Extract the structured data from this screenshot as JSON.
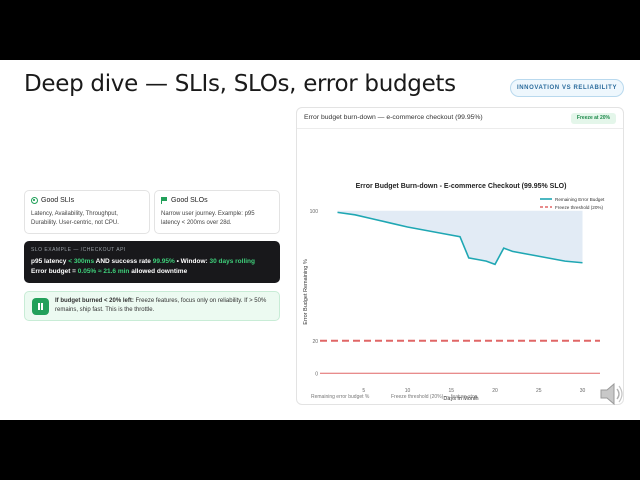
{
  "slide": {
    "title": "Deep dive — SLIs, SLOs, error budgets",
    "tag": "INNOVATION VS RELIABILITY"
  },
  "cards": {
    "sli": {
      "title": "Good SLIs",
      "body": "Latency, Availability, Throughput, Durability. User-centric, not CPU."
    },
    "slo": {
      "title": "Good SLOs",
      "body": "Narrow user journey. Example: p95 latency < 200ms over 28d."
    }
  },
  "example": {
    "label": "SLO EXAMPLE — /CHECKOUT API",
    "line1": {
      "a": "p95 latency ",
      "b": "< 300ms",
      "c": " AND success rate ",
      "d": "99.95%",
      "e": " • Window: ",
      "f": "30 days rolling"
    },
    "line2": {
      "a": "Error budget = ",
      "b": "0.05% ≈ 21.6 min",
      "c": " allowed downtime"
    }
  },
  "freeze": {
    "bold": "If budget burned < 20% left:",
    "text": " Freeze features, focus only on reliability. If > 50% remains, ship fast. This is the throttle."
  },
  "panel": {
    "title": "Error budget burn-down — e-commerce checkout (99.95%)",
    "badge": "Freeze at 20%",
    "footer_left": "Remaining error budget %",
    "footer_right": "Freeze threshold (20%) — feature stop"
  },
  "colors": {
    "line": "#1fa7b3",
    "fill": "#dde7f3",
    "threshold": "#e06666",
    "accent": "#22a05a"
  },
  "chart_data": {
    "type": "line",
    "title": "Error Budget Burn-down - E-commerce Checkout (99.95% SLO)",
    "xlabel": "Days in Month",
    "ylabel": "Error Budget Remaining %",
    "xlim": [
      0,
      32
    ],
    "ylim": [
      -6,
      106
    ],
    "xticks": [
      5,
      10,
      15,
      20,
      25,
      30
    ],
    "yticks": [
      0,
      20,
      100
    ],
    "ytick_labels": [
      "0",
      "20",
      "100"
    ],
    "legend_position": "top-right",
    "series": [
      {
        "name": "Remaining Error Budget",
        "x": [
          2,
          4,
          6,
          8,
          10,
          12,
          14,
          16,
          17,
          18,
          19,
          20,
          21,
          22,
          24,
          26,
          28,
          30
        ],
        "y": [
          99,
          97.5,
          95,
          92.5,
          90,
          88,
          86,
          84,
          71,
          70,
          69,
          67,
          77,
          75,
          73,
          71,
          69,
          68
        ]
      },
      {
        "name": "Freeze threshold (20%)",
        "x": [
          0,
          32
        ],
        "y": [
          20,
          20
        ]
      }
    ],
    "zero_line": 0
  }
}
